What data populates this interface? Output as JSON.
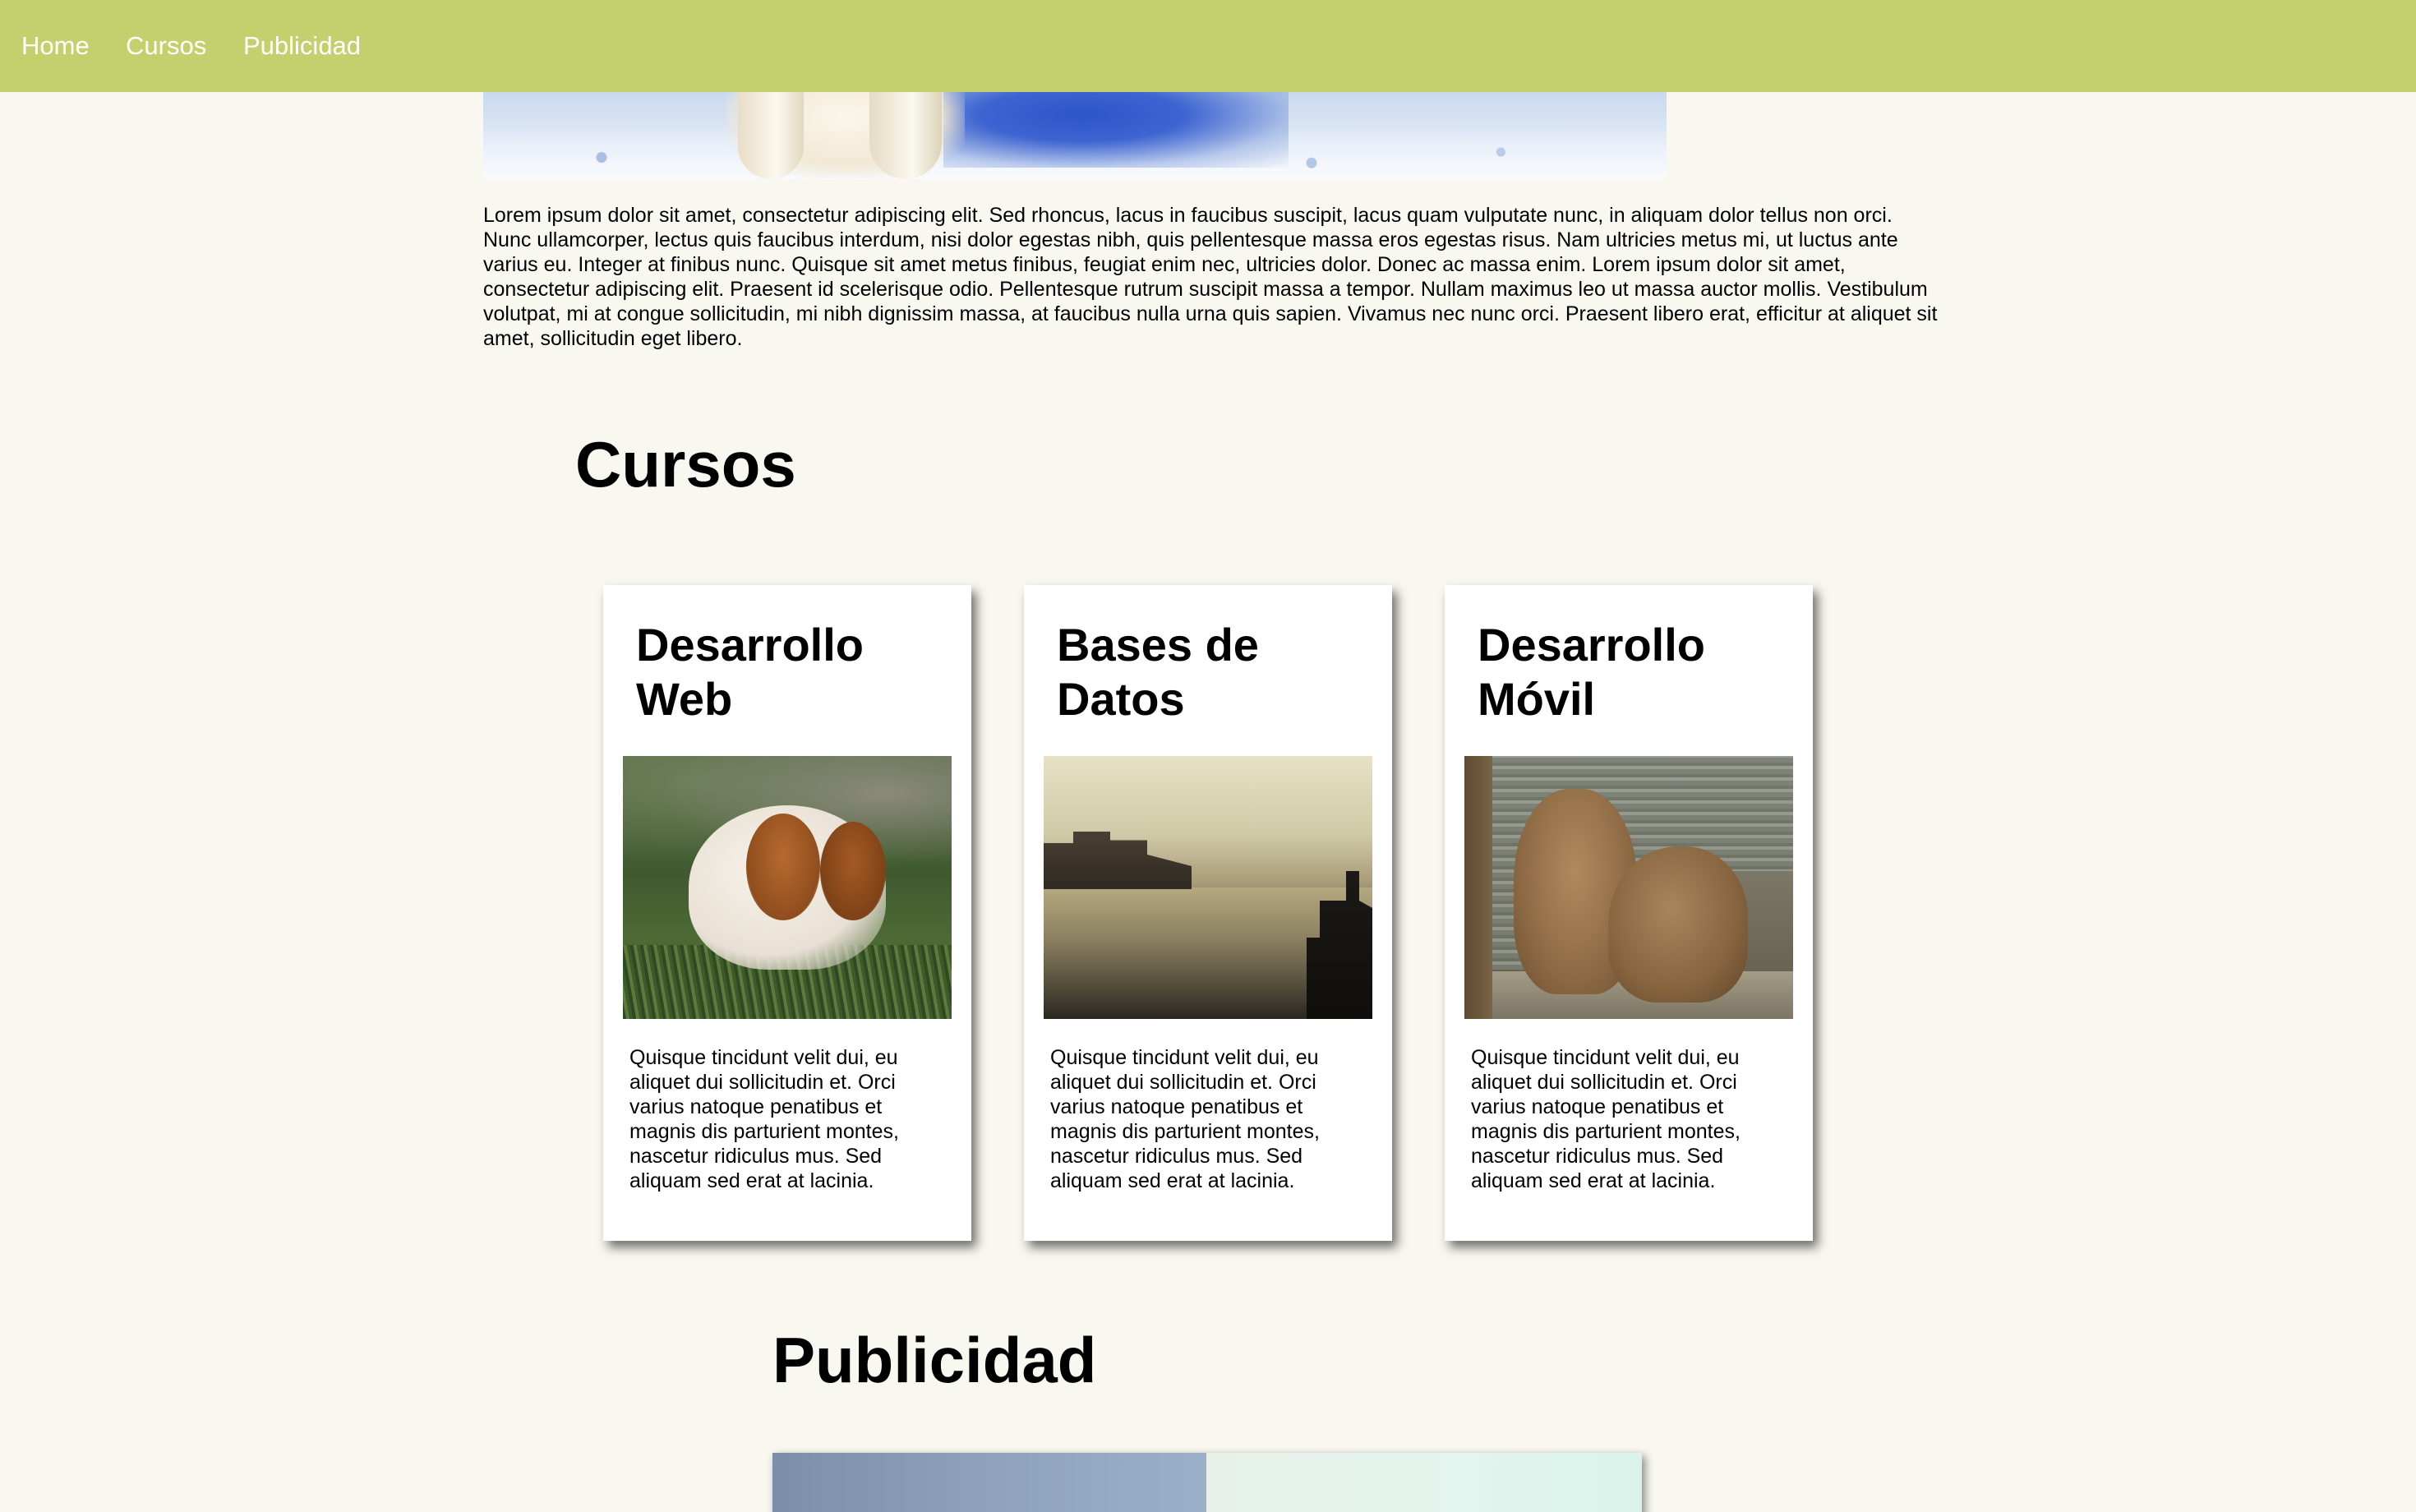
{
  "nav": {
    "items": [
      {
        "label": "Home"
      },
      {
        "label": "Cursos"
      },
      {
        "label": "Publicidad"
      }
    ]
  },
  "hero": {
    "image": "polar-bear-on-snow"
  },
  "intro": {
    "text": "Lorem ipsum dolor sit amet, consectetur adipiscing elit. Sed rhoncus, lacus in faucibus suscipit, lacus quam vulputate nunc, in aliquam dolor tellus non orci. Nunc ullamcorper, lectus quis faucibus interdum, nisi dolor egestas nibh, quis pellentesque massa eros egestas risus. Nam ultricies metus mi, ut luctus ante varius eu. Integer at finibus nunc. Quisque sit amet metus finibus, feugiat enim nec, ultricies dolor. Donec ac massa enim. Lorem ipsum dolor sit amet, consectetur adipiscing elit. Praesent id scelerisque odio. Pellentesque rutrum suscipit massa a tempor. Nullam maximus leo ut massa auctor mollis. Vestibulum volutpat, mi at congue sollicitudin, mi nibh dignissim massa, at faucibus nulla urna quis sapien. Vivamus nec nunc orci. Praesent libero erat, efficitur at aliquet sit amet, sollicitudin eget libero."
  },
  "cursos": {
    "title": "Cursos",
    "cards": [
      {
        "title": "Desarrollo Web",
        "image": "puppy-on-grass",
        "text": "Quisque tincidunt velit dui, eu aliquet dui sollicitudin et. Orci varius natoque penatibus et magnis dis parturient montes, nascetur ridiculus mus. Sed aliquam sed erat at lacinia."
      },
      {
        "title": "Bases de Datos",
        "image": "river-city-boat",
        "text": "Quisque tincidunt velit dui, eu aliquet dui sollicitudin et. Orci varius natoque penatibus et magnis dis parturient montes, nascetur ridiculus mus. Sed aliquam sed erat at lacinia."
      },
      {
        "title": "Desarrollo Móvil",
        "image": "bears-by-water",
        "text": "Quisque tincidunt velit dui, eu aliquet dui sollicitudin et. Orci varius natoque penatibus et magnis dis parturient montes, nascetur ridiculus mus. Sed aliquam sed erat at lacinia."
      }
    ]
  },
  "publicidad": {
    "title": "Publicidad",
    "image": "ad-banner"
  },
  "colors": {
    "navbar": "#c4d06e",
    "background": "#f8f7f0",
    "nav_text": "#ffffff"
  }
}
